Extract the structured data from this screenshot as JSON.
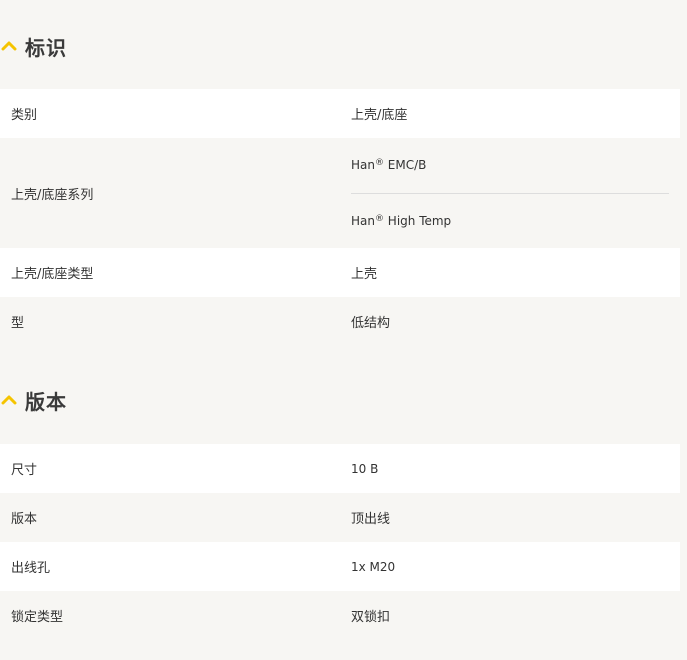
{
  "colors": {
    "accent": "#f5c400",
    "background": "#f7f6f3",
    "row_white": "#ffffff"
  },
  "sections": [
    {
      "title": "标识",
      "icon": "chevron-up-icon",
      "rows": [
        {
          "label": "类别",
          "value": "上壳/底座"
        },
        {
          "label": "上壳/底座系列",
          "values": [
            {
              "brand": "Han",
              "mark": "®",
              "rest": " EMC/B"
            },
            {
              "brand": "Han",
              "mark": "®",
              "rest": " High Temp"
            }
          ]
        },
        {
          "label": "上壳/底座类型",
          "value": "上壳"
        },
        {
          "label": "型",
          "value": "低结构"
        }
      ]
    },
    {
      "title": "版本",
      "icon": "chevron-up-icon",
      "rows": [
        {
          "label": "尺寸",
          "value": "10 B"
        },
        {
          "label": "版本",
          "value": "顶出线"
        },
        {
          "label": "出线孔",
          "value": "1x M20"
        },
        {
          "label": "锁定类型",
          "value": "双锁扣"
        }
      ]
    }
  ]
}
